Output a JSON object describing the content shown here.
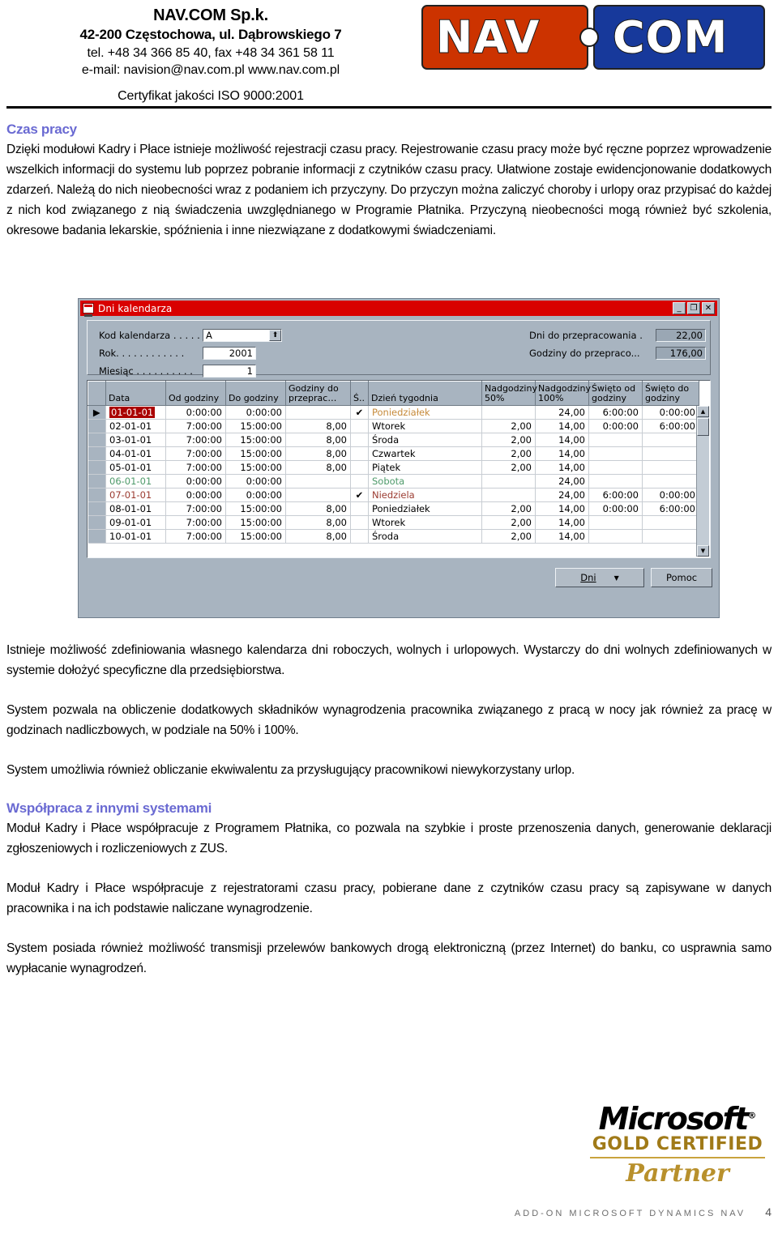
{
  "letterhead": {
    "company_name": "NAV.COM Sp.k.",
    "address": "42-200 Częstochowa, ul. Dąbrowskiego 7",
    "tel": "tel. +48 34 366 85 40, fax +48 34 361 58 11",
    "email": "e-mail: navision@nav.com.pl   www.nav.com.pl",
    "certificate": "Certyfikat jakości ISO 9000:2001",
    "logo": {
      "left_text": "NAV",
      "right_text": "COM"
    }
  },
  "document": {
    "heading_1": "Czas pracy",
    "paragraph_1": "Dzięki modułowi Kadry i Płace istnieje możliwość rejestracji czasu pracy. Rejestrowanie czasu pracy może być ręczne poprzez wprowadzenie wszelkich informacji do systemu lub poprzez pobranie informacji z czytników czasu pracy. Ułatwione zostaje ewidencjonowanie dodatkowych zdarzeń. Należą do nich nieobecności wraz z podaniem ich przyczyny. Do przyczyn można zaliczyć choroby i urlopy oraz przypisać do każdej z nich kod związanego z nią świadczenia uwzględnianego w Programie Płatnika. Przyczyną nieobecności mogą również być szkolenia, okresowe badania lekarskie, spóźnienia i inne niezwiązane z dodatkowymi świadczeniami.",
    "paragraph_2": "Istnieje możliwość zdefiniowania własnego kalendarza dni roboczych, wolnych i urlopowych. Wystarczy do dni wolnych zdefiniowanych w systemie dołożyć specyficzne dla przedsiębiorstwa.",
    "paragraph_3": "System pozwala na obliczenie dodatkowych składników wynagrodzenia pracownika związanego z pracą w nocy jak również za pracę w godzinach nadliczbowych, w podziale na 50% i 100%.",
    "paragraph_4": "System umożliwia również obliczanie ekwiwalentu za przysługujący pracownikowi niewykorzystany urlop.",
    "heading_2": "Współpraca z innymi systemami",
    "paragraph_5": "Moduł Kadry i Płace współpracuje z Programem Płatnika, co pozwala na szybkie i proste przenoszenia danych, generowanie deklaracji zgłoszeniowych i rozliczeniowych z ZUS.",
    "paragraph_6": "Moduł Kadry i Płace współpracuje z rejestratorami czasu pracy, pobierane dane z czytników czasu pracy są zapisywane w danych pracownika i na ich podstawie naliczane wynagrodzenie.",
    "paragraph_7": "System posiada również możliwość transmisji przelewów bankowych drogą elektroniczną (przez Internet) do banku, co usprawnia samo wypłacanie wynagrodzeń."
  },
  "app_window": {
    "title": "Dni kalendarza",
    "window_buttons": {
      "minimize": "_",
      "maximize": "❐",
      "close": "✕"
    },
    "fields_left": [
      {
        "label": "Kod kalendarza . . . . . .",
        "value": "A"
      },
      {
        "label": "Rok. . . . . . . . . . . .",
        "value": "2001"
      },
      {
        "label": "Miesiąc . . . . . . . . . .",
        "value": "1"
      }
    ],
    "fields_right": [
      {
        "label": "Dni do przepracowania  .",
        "value": "22,00"
      },
      {
        "label": "Godziny do przepraco...",
        "value": "176,00"
      }
    ],
    "grid": {
      "columns": [
        "Data",
        "Od godziny",
        "Do godziny",
        "Godziny do przeprac…",
        "Ś..",
        "Dzień tygodnia",
        "Nadgodziny 50%",
        "Nadgodziny 100%",
        "Święto od godziny",
        "Święto do godziny"
      ],
      "rows": [
        {
          "data": "01-01-01",
          "od": "0:00:00",
          "do": "0:00:00",
          "godziny": "",
          "s": "✔",
          "dzien": "Poniedziałek",
          "n50": "",
          "n100": "24,00",
          "swod": "6:00:00",
          "swdo": "0:00:00",
          "style": "holiday",
          "selected": true
        },
        {
          "data": "02-01-01",
          "od": "7:00:00",
          "do": "15:00:00",
          "godziny": "8,00",
          "s": "",
          "dzien": "Wtorek",
          "n50": "2,00",
          "n100": "14,00",
          "swod": "0:00:00",
          "swdo": "6:00:00",
          "style": "normal",
          "selected": false
        },
        {
          "data": "03-01-01",
          "od": "7:00:00",
          "do": "15:00:00",
          "godziny": "8,00",
          "s": "",
          "dzien": "Środa",
          "n50": "2,00",
          "n100": "14,00",
          "swod": "",
          "swdo": "",
          "style": "normal",
          "selected": false
        },
        {
          "data": "04-01-01",
          "od": "7:00:00",
          "do": "15:00:00",
          "godziny": "8,00",
          "s": "",
          "dzien": "Czwartek",
          "n50": "2,00",
          "n100": "14,00",
          "swod": "",
          "swdo": "",
          "style": "normal",
          "selected": false
        },
        {
          "data": "05-01-01",
          "od": "7:00:00",
          "do": "15:00:00",
          "godziny": "8,00",
          "s": "",
          "dzien": "Piątek",
          "n50": "2,00",
          "n100": "14,00",
          "swod": "",
          "swdo": "",
          "style": "normal",
          "selected": false
        },
        {
          "data": "06-01-01",
          "od": "0:00:00",
          "do": "0:00:00",
          "godziny": "",
          "s": "",
          "dzien": "Sobota",
          "n50": "",
          "n100": "24,00",
          "swod": "",
          "swdo": "",
          "style": "saturday",
          "selected": false
        },
        {
          "data": "07-01-01",
          "od": "0:00:00",
          "do": "0:00:00",
          "godziny": "",
          "s": "✔",
          "dzien": "Niedziela",
          "n50": "",
          "n100": "24,00",
          "swod": "6:00:00",
          "swdo": "0:00:00",
          "style": "sunday",
          "selected": false
        },
        {
          "data": "08-01-01",
          "od": "7:00:00",
          "do": "15:00:00",
          "godziny": "8,00",
          "s": "",
          "dzien": "Poniedziałek",
          "n50": "2,00",
          "n100": "14,00",
          "swod": "0:00:00",
          "swdo": "6:00:00",
          "style": "normal",
          "selected": false
        },
        {
          "data": "09-01-01",
          "od": "7:00:00",
          "do": "15:00:00",
          "godziny": "8,00",
          "s": "",
          "dzien": "Wtorek",
          "n50": "2,00",
          "n100": "14,00",
          "swod": "",
          "swdo": "",
          "style": "normal",
          "selected": false
        },
        {
          "data": "10-01-01",
          "od": "7:00:00",
          "do": "15:00:00",
          "godziny": "8,00",
          "s": "",
          "dzien": "Środa",
          "n50": "2,00",
          "n100": "14,00",
          "swod": "",
          "swdo": "",
          "style": "normal",
          "selected": false
        }
      ]
    },
    "buttons": {
      "dni": "Dni",
      "dni_arrow": "▼",
      "pomoc": "Pomoc"
    }
  },
  "ms_logo": {
    "microsoft": "Microsoft",
    "registered": "®",
    "gold_certified": "GOLD CERTIFIED",
    "partner": "Partner"
  },
  "footer": {
    "text": "ADD-ON MICROSOFT DYNAMICS NAV",
    "page": "4"
  },
  "colors": {
    "heading": "#6a6ad2",
    "logo_red": "#cc3300",
    "logo_blue": "#17399b",
    "titlebar": "#d90000",
    "gold": "#b8902c"
  }
}
